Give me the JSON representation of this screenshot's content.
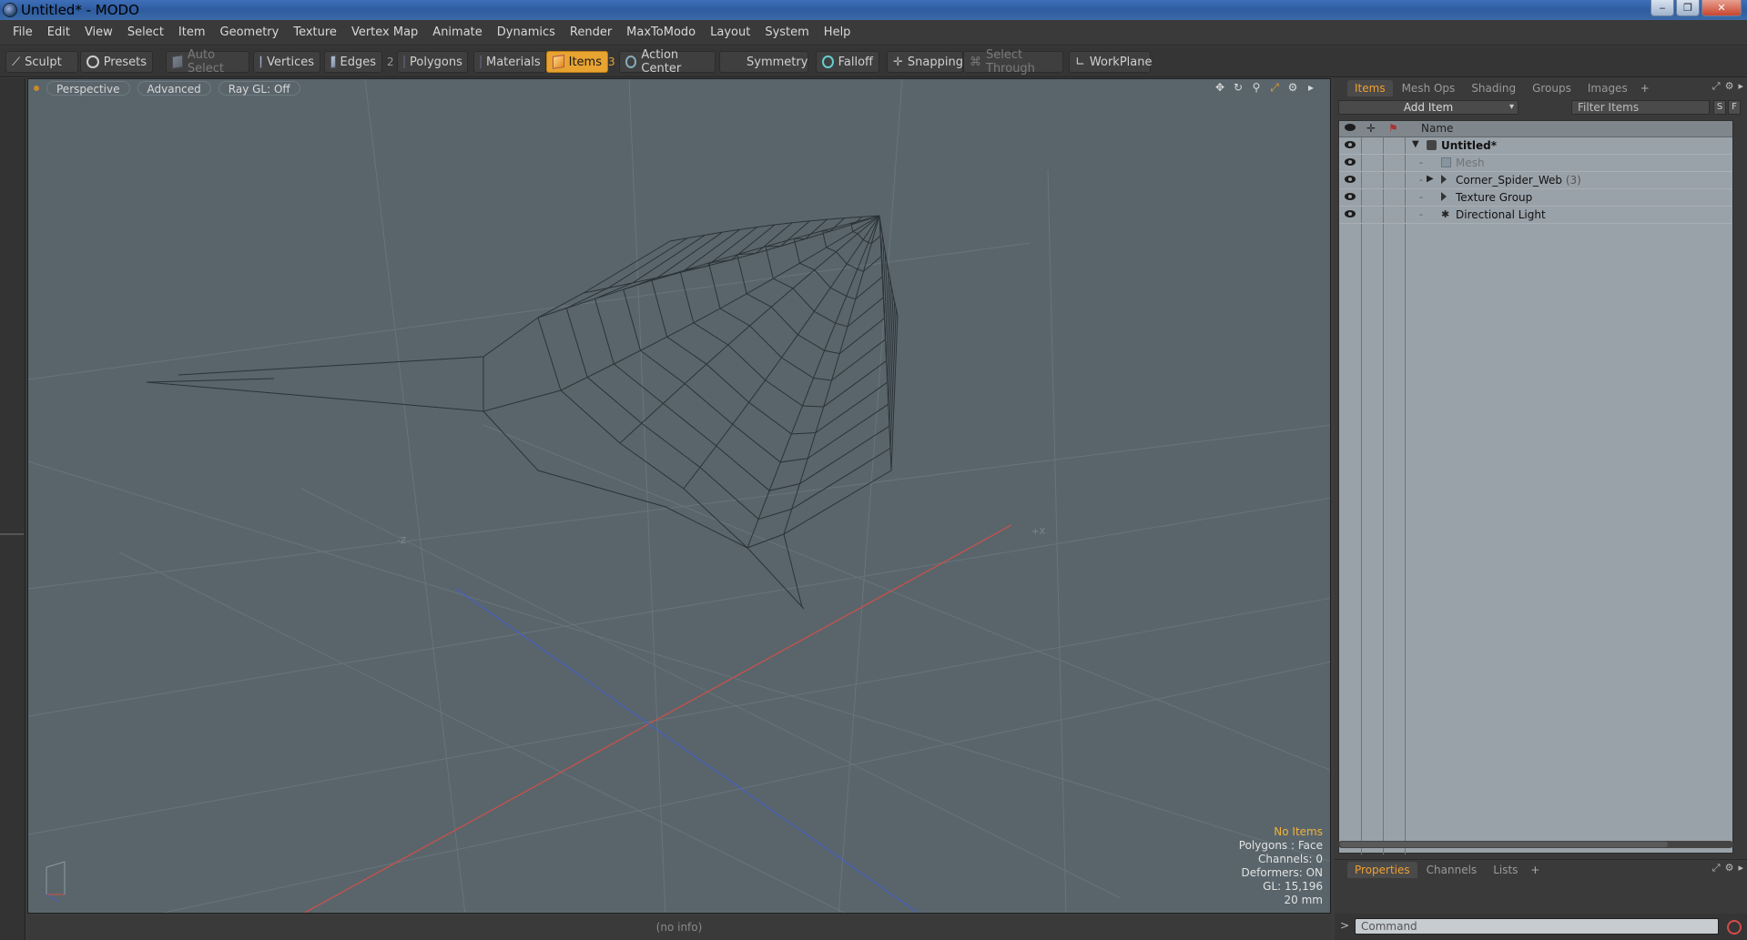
{
  "window": {
    "title": "Untitled* - MODO"
  },
  "menu": [
    "File",
    "Edit",
    "View",
    "Select",
    "Item",
    "Geometry",
    "Texture",
    "Vertex Map",
    "Animate",
    "Dynamics",
    "Render",
    "MaxToModo",
    "Layout",
    "System",
    "Help"
  ],
  "toolbar": {
    "sculpt": "Sculpt",
    "presets": "Presets",
    "auto_select": "Auto Select",
    "vertices": "Vertices",
    "edges": "Edges",
    "edges_count": "2",
    "polygons": "Polygons",
    "materials": "Materials",
    "items": "Items",
    "items_count": "3",
    "action_center": "Action Center",
    "symmetry": "Symmetry",
    "falloff": "Falloff",
    "snapping": "Snapping",
    "select_through": "Select Through",
    "workplane": "WorkPlane"
  },
  "viewport": {
    "view_mode": "Perspective",
    "shading": "Advanced",
    "raygl": "Ray GL: Off",
    "axis_neg_z": "-Z",
    "axis_pos_x": "+X",
    "info": {
      "selection": "No Items",
      "polygons": "Polygons : Face",
      "channels": "Channels: 0",
      "deformers": "Deformers: ON",
      "gl": "GL: 15,196",
      "scale": "20 mm"
    },
    "colors": {
      "background": "#59656b",
      "x_axis": "#d0504a",
      "z_axis": "#4a5fc0",
      "web": "#2c3338"
    }
  },
  "status": {
    "text": "(no info)"
  },
  "items_panel": {
    "tabs": [
      "Items",
      "Mesh Ops",
      "Shading",
      "Groups",
      "Images",
      "+"
    ],
    "add_item": "Add Item",
    "filter_placeholder": "Filter Items",
    "btn_s": "S",
    "btn_f": "F",
    "column_name": "Name",
    "rows": [
      {
        "label": "Untitled*",
        "icon": "scene-icon",
        "style": "bold"
      },
      {
        "label": "Mesh",
        "icon": "mesh-icon",
        "style": "disabled"
      },
      {
        "label": "Corner_Spider_Web",
        "count": "(3)",
        "icon": "group-icon",
        "style": "normal"
      },
      {
        "label": "Texture Group",
        "icon": "group-icon",
        "style": "normal"
      },
      {
        "label": "Directional Light",
        "icon": "light-icon",
        "style": "normal"
      }
    ]
  },
  "properties_panel": {
    "tabs": [
      "Properties",
      "Channels",
      "Lists",
      "+"
    ]
  },
  "command": {
    "prompt": ">",
    "placeholder": "Command"
  }
}
